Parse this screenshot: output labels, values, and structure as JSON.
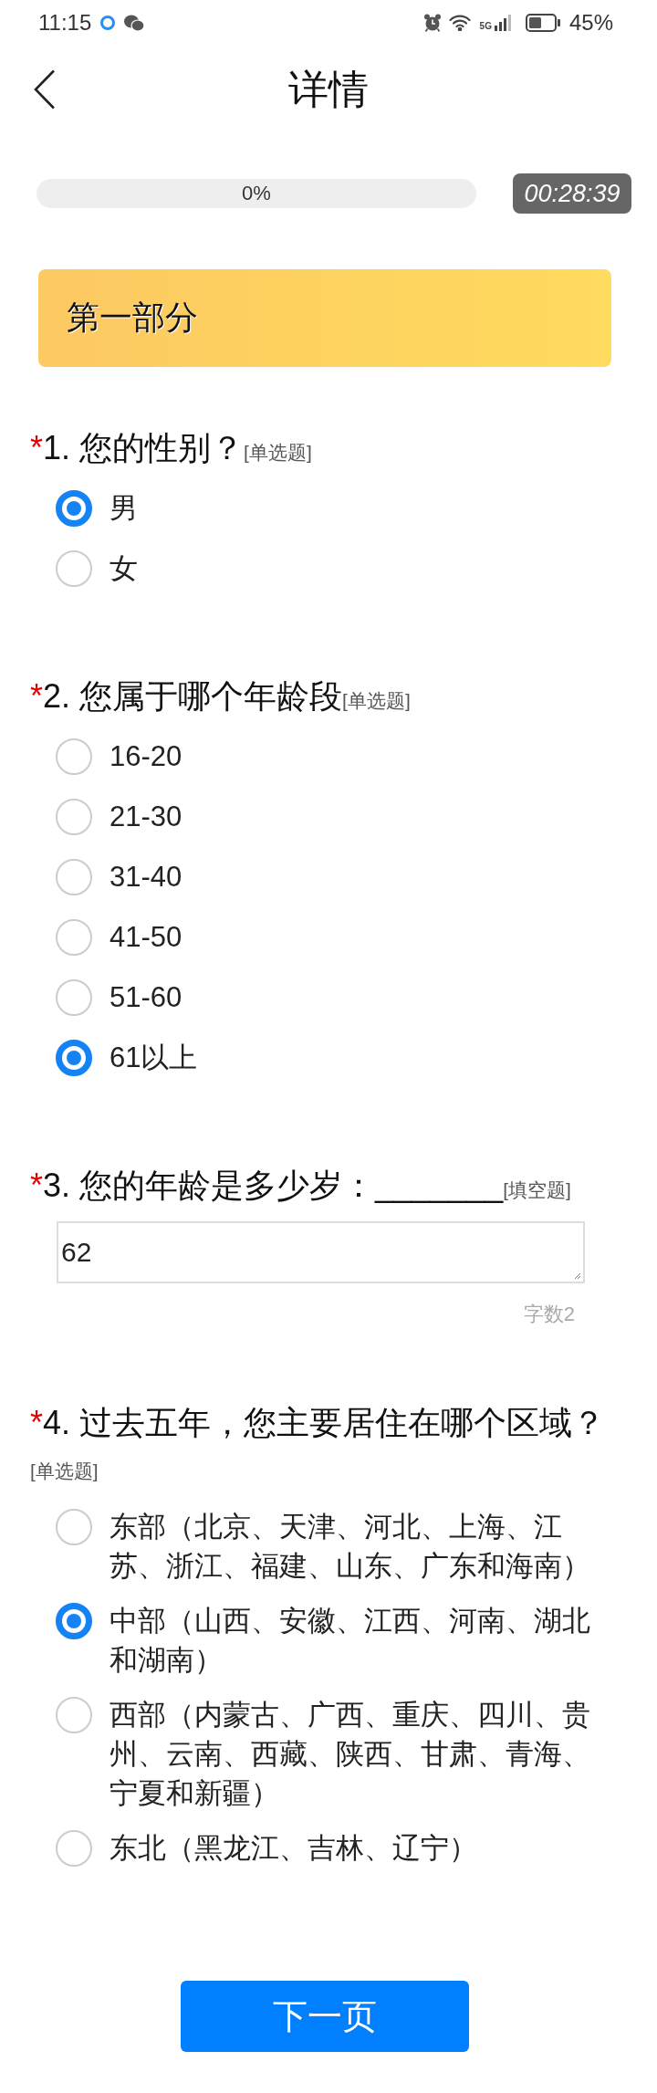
{
  "status_bar": {
    "time": "11:15",
    "network": "5G",
    "battery": "45%"
  },
  "header": {
    "title": "详情"
  },
  "progress": {
    "reading": "0%"
  },
  "timer": {
    "text": "00:28:39"
  },
  "section": {
    "title": "第一部分"
  },
  "questions": [
    {
      "kind": "choice",
      "mark": "*",
      "title": "1. 您的性别？",
      "tag": "[单选题]",
      "options": [
        {
          "label": "男",
          "selected": true
        },
        {
          "label": "女",
          "selected": false
        }
      ]
    },
    {
      "kind": "choice",
      "mark": "*",
      "title": "2. 您属于哪个年龄段",
      "tag": "[单选题]",
      "options": [
        {
          "label": "16-20",
          "selected": false
        },
        {
          "label": "21-30",
          "selected": false
        },
        {
          "label": "31-40",
          "selected": false
        },
        {
          "label": "41-50",
          "selected": false
        },
        {
          "label": "51-60",
          "selected": false
        },
        {
          "label": "61以上",
          "selected": true
        }
      ]
    },
    {
      "kind": "text",
      "mark": "*",
      "title": "3. 您的年龄是多少岁：_______",
      "tag": "[填空题]",
      "answer": "62",
      "counter": "字数2"
    },
    {
      "kind": "choice",
      "mark": "*",
      "title": "4. 过去五年，您主要居住在哪个区域？",
      "tag": "[单选题]",
      "options": [
        {
          "label": "东部（北京、天津、河北、上海、江苏、浙江、福建、山东、广东和海南）",
          "selected": false
        },
        {
          "label": "中部（山西、安徽、江西、河南、湖北和湖南）",
          "selected": true
        },
        {
          "label": "西部（内蒙古、广西、重庆、四川、贵州、云南、西藏、陕西、甘肃、青海、宁夏和新疆）",
          "selected": false
        },
        {
          "label": "东北（黑龙江、吉林、辽宁）",
          "selected": false
        }
      ]
    }
  ],
  "next_button": {
    "label": "下一页"
  }
}
